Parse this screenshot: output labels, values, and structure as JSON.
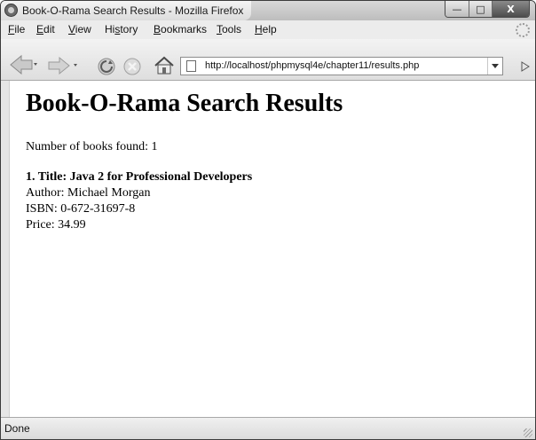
{
  "window": {
    "title": "Book-O-Rama Search Results - Mozilla Firefox",
    "minimize_glyph": "—",
    "maximize_glyph": "□",
    "close_glyph": "X"
  },
  "menu": [
    {
      "key": "F",
      "rest": "ile"
    },
    {
      "key": "E",
      "rest": "dit"
    },
    {
      "key": "V",
      "rest": "iew"
    },
    {
      "pre": "Hi",
      "key": "s",
      "rest": "tory"
    },
    {
      "key": "B",
      "rest": "ookmarks"
    },
    {
      "key": "T",
      "rest": "ools"
    },
    {
      "key": "H",
      "rest": "elp"
    }
  ],
  "toolbar": {
    "url": "http://localhost/phpmysql4e/chapter11/results.php",
    "icons": [
      "back-icon",
      "forward-icon",
      "reload-icon",
      "stop-icon",
      "home-icon",
      "page-icon",
      "dropdown-icon",
      "go-icon"
    ]
  },
  "page": {
    "heading": "Book-O-Rama Search Results",
    "count_text": "Number of books found: 1",
    "book": {
      "title_line": "1. Title: Java 2 for Professional Developers",
      "author_line": "Author: Michael Morgan",
      "isbn_line": "ISBN: 0-672-31697-8",
      "price_line": "Price: 34.99"
    }
  },
  "status": {
    "text": "Done"
  }
}
